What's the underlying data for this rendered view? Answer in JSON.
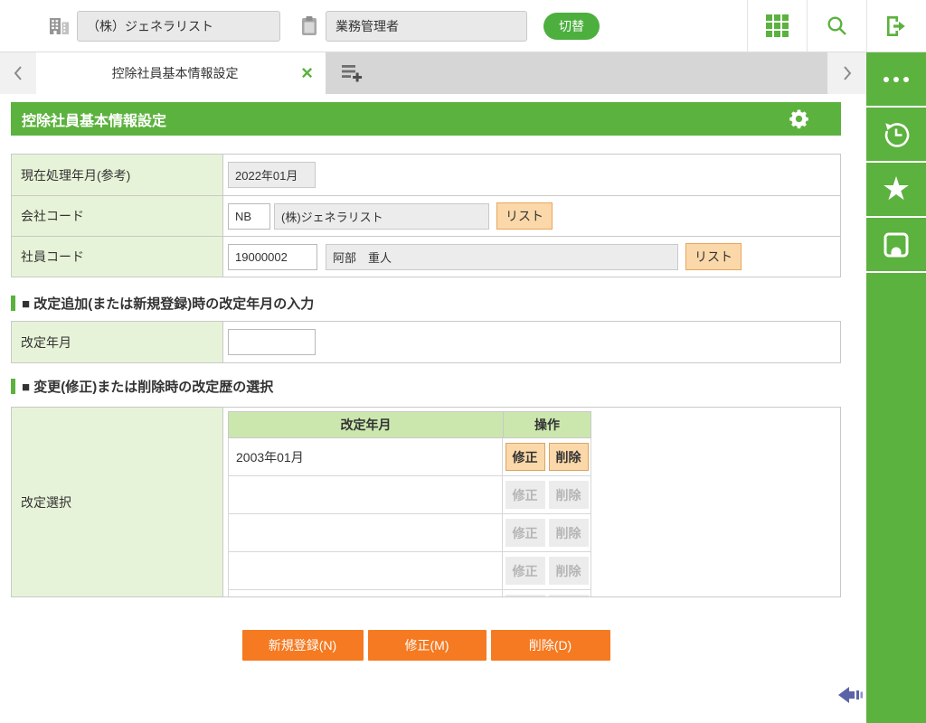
{
  "topbar": {
    "company_value": "（株）ジェネラリスト",
    "role_value": "業務管理者",
    "switch_label": "切替"
  },
  "tabbar": {
    "active_tab": "控除社員基本情報設定"
  },
  "main": {
    "title": "控除社員基本情報設定",
    "form": {
      "current_month_label": "現在処理年月(参考)",
      "current_month_value": "2022年01月",
      "company_code_label": "会社コード",
      "company_code": "NB",
      "company_name": "(株)ジェネラリスト",
      "employee_code_label": "社員コード",
      "employee_code": "19000002",
      "employee_name": "阿部　重人",
      "list_button": "リスト"
    },
    "section_add": {
      "title": "■ 改定追加(または新規登録)時の改定年月の入力",
      "row_label": "改定年月",
      "input_value": ""
    },
    "section_select": {
      "title": "■ 変更(修正)または削除時の改定歴の選択",
      "row_label": "改定選択",
      "table": {
        "col_month": "改定年月",
        "col_action": "操作",
        "edit_label": "修正",
        "delete_label": "削除",
        "rows": [
          {
            "month": "2003年01月",
            "enabled": true
          },
          {
            "month": "",
            "enabled": false
          },
          {
            "month": "",
            "enabled": false
          },
          {
            "month": "",
            "enabled": false
          },
          {
            "month": "",
            "enabled": false
          }
        ]
      }
    },
    "footer_buttons": {
      "new": "新規登録(N)",
      "edit": "修正(M)",
      "delete": "削除(D)"
    }
  },
  "colors": {
    "green": "#5cb23e",
    "pale_green": "#e7f3d8",
    "table_header_green": "#cbe7ae",
    "orange": "#f57a21",
    "peach": "#fbd8a9",
    "arrow_blue": "#5b63a8"
  }
}
